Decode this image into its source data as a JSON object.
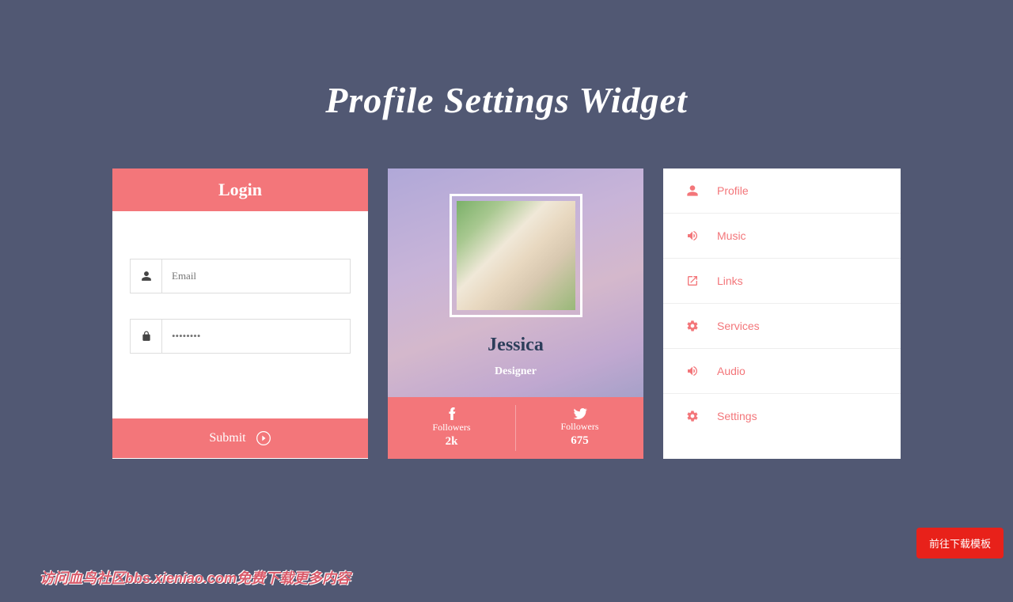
{
  "title": "Profile Settings Widget",
  "login": {
    "header": "Login",
    "email_placeholder": "Email",
    "password_placeholder": "••••••••",
    "submit": "Submit"
  },
  "profile": {
    "name": "Jessica",
    "role": "Designer",
    "fb_label": "Followers",
    "fb_value": "2k",
    "tw_label": "Followers",
    "tw_value": "675"
  },
  "menu": {
    "items": [
      {
        "label": "Profile"
      },
      {
        "label": "Music"
      },
      {
        "label": "Links"
      },
      {
        "label": "Services"
      },
      {
        "label": "Audio"
      },
      {
        "label": "Settings"
      }
    ]
  },
  "download_btn": "前往下载模板",
  "watermark": "访问血鸟社区bbs.xieniao.com免费下载更多内容"
}
